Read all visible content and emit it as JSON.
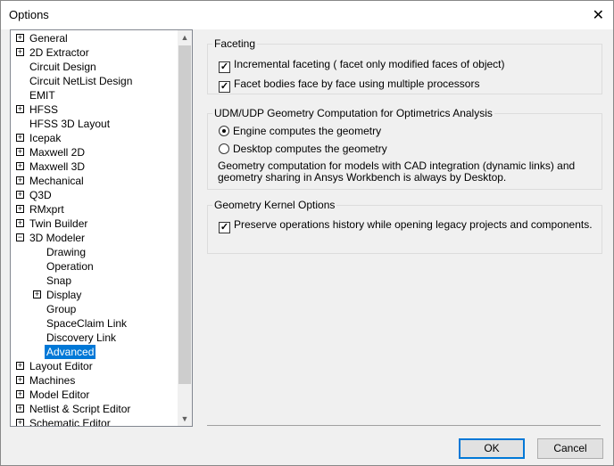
{
  "window": {
    "title": "Options",
    "close_icon": "close-icon"
  },
  "tree": {
    "items": [
      {
        "label": "General",
        "level": 0,
        "expander": "+"
      },
      {
        "label": "2D Extractor",
        "level": 0,
        "expander": "+"
      },
      {
        "label": "Circuit Design",
        "level": 0,
        "expander": ""
      },
      {
        "label": "Circuit NetList Design",
        "level": 0,
        "expander": ""
      },
      {
        "label": "EMIT",
        "level": 0,
        "expander": ""
      },
      {
        "label": "HFSS",
        "level": 0,
        "expander": "+"
      },
      {
        "label": "HFSS 3D Layout",
        "level": 0,
        "expander": ""
      },
      {
        "label": "Icepak",
        "level": 0,
        "expander": "+"
      },
      {
        "label": "Maxwell 2D",
        "level": 0,
        "expander": "+"
      },
      {
        "label": "Maxwell 3D",
        "level": 0,
        "expander": "+"
      },
      {
        "label": "Mechanical",
        "level": 0,
        "expander": "+"
      },
      {
        "label": "Q3D",
        "level": 0,
        "expander": "+"
      },
      {
        "label": "RMxprt",
        "level": 0,
        "expander": "+"
      },
      {
        "label": "Twin Builder",
        "level": 0,
        "expander": "+"
      },
      {
        "label": "3D Modeler",
        "level": 0,
        "expander": "−"
      },
      {
        "label": "Drawing",
        "level": 1,
        "expander": ""
      },
      {
        "label": "Operation",
        "level": 1,
        "expander": ""
      },
      {
        "label": "Snap",
        "level": 1,
        "expander": ""
      },
      {
        "label": "Display",
        "level": 1,
        "expander": "+"
      },
      {
        "label": "Group",
        "level": 1,
        "expander": ""
      },
      {
        "label": "SpaceClaim Link",
        "level": 1,
        "expander": ""
      },
      {
        "label": "Discovery Link",
        "level": 1,
        "expander": ""
      },
      {
        "label": "Advanced",
        "level": 1,
        "expander": "",
        "selected": true
      },
      {
        "label": "Layout Editor",
        "level": 0,
        "expander": "+"
      },
      {
        "label": "Machines",
        "level": 0,
        "expander": "+"
      },
      {
        "label": "Model Editor",
        "level": 0,
        "expander": "+"
      },
      {
        "label": "Netlist & Script Editor",
        "level": 0,
        "expander": "+"
      },
      {
        "label": "Schematic Editor",
        "level": 0,
        "expander": "+"
      }
    ],
    "selected_color": "#0078d7"
  },
  "faceting": {
    "title": "Faceting",
    "incremental": {
      "label": "Incremental faceting  ( facet only modified faces of object)",
      "checked": true
    },
    "parallel": {
      "label": "Facet bodies face by face using multiple processors",
      "checked": true
    }
  },
  "udm": {
    "title": "UDM/UDP Geometry Computation for Optimetrics Analysis",
    "engine": {
      "label": "Engine computes the geometry",
      "selected": true
    },
    "desktop": {
      "label": "Desktop computes the geometry",
      "selected": false
    },
    "note": "Geometry computation for models with CAD integration (dynamic links) and geometry sharing in Ansys Workbench is always by Desktop."
  },
  "kernel": {
    "title": "Geometry Kernel Options",
    "preserve": {
      "label": "Preserve operations history while opening legacy projects and components.",
      "checked": true
    }
  },
  "buttons": {
    "ok": "OK",
    "cancel": "Cancel"
  }
}
